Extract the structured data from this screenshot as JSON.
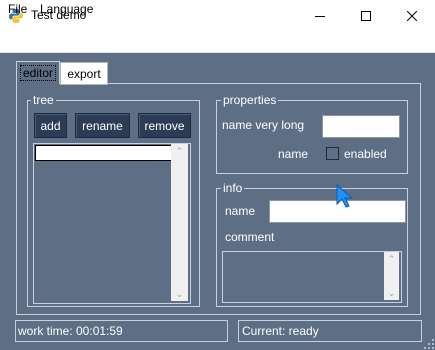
{
  "window": {
    "title": "Test demo",
    "icon": "python-icon",
    "controls": {
      "minimize": "—",
      "maximize": "☐",
      "close": "✕"
    }
  },
  "menu": {
    "items": [
      "File",
      "Language"
    ]
  },
  "tabs": [
    {
      "label": "editor",
      "active": true
    },
    {
      "label": "export",
      "active": false
    }
  ],
  "tree": {
    "title": "tree",
    "buttons": {
      "add": "add",
      "rename": "rename",
      "remove": "remove"
    },
    "scroll_up": "⌃",
    "scroll_down": "⌄"
  },
  "properties": {
    "title": "properties",
    "row_label": "name very long",
    "row_value": "",
    "name_label": "name",
    "enabled_label": "enabled",
    "enabled_checked": false
  },
  "info": {
    "title": "info",
    "name_label": "name",
    "name_value": "",
    "comment_label": "comment",
    "comment_value": ""
  },
  "status": {
    "work_time": "work time: 00:01:59",
    "current": "Current: ready"
  },
  "colors": {
    "background": "#5e6e85",
    "button": "#2e3b55",
    "cursor": "#1e90ff"
  }
}
